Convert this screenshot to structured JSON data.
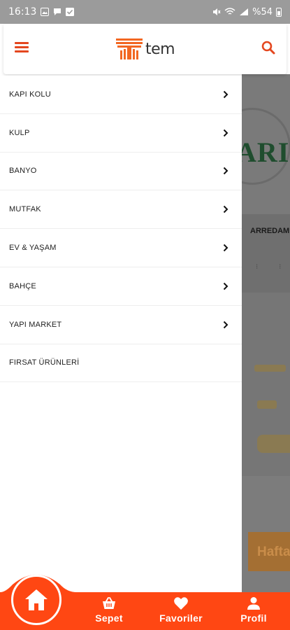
{
  "status_bar": {
    "time": "16:13",
    "battery": "%54",
    "left_icons": [
      "image-icon",
      "chat-icon",
      "checkbox-icon"
    ],
    "right_icons": [
      "mute-icon",
      "wifi-icon",
      "signal-icon",
      "battery-icon"
    ]
  },
  "header": {
    "logo_text": "tem",
    "menu_icon": "hamburger-menu-icon",
    "search_icon": "search-icon"
  },
  "drawer": {
    "items": [
      {
        "label": "KAPI KOLU",
        "has_submenu": true
      },
      {
        "label": "KULP",
        "has_submenu": true
      },
      {
        "label": "BANYO",
        "has_submenu": true
      },
      {
        "label": "MUTFAK",
        "has_submenu": true
      },
      {
        "label": "EV & YAŞAM",
        "has_submenu": true
      },
      {
        "label": "BAHÇE",
        "has_submenu": true
      },
      {
        "label": "YAPI MARKET",
        "has_submenu": true
      },
      {
        "label": "FIRSAT ÜRÜNLERİ",
        "has_submenu": false
      }
    ]
  },
  "background": {
    "logo_fragment": "ARIT",
    "brand_fragment": "ARREDAMI",
    "banner_fragment": "Hafta"
  },
  "bottom_nav": {
    "home_icon": "home-icon",
    "items": [
      {
        "label": "Sepet",
        "icon": "basket-icon"
      },
      {
        "label": "Favoriler",
        "icon": "heart-icon"
      },
      {
        "label": "Profil",
        "icon": "user-icon"
      }
    ]
  },
  "colors": {
    "brand_orange": "#ff4713",
    "icon_orange": "#e4471f",
    "status_bar": "#9b9b9b",
    "overlay_gray": "#6f6f6f"
  }
}
